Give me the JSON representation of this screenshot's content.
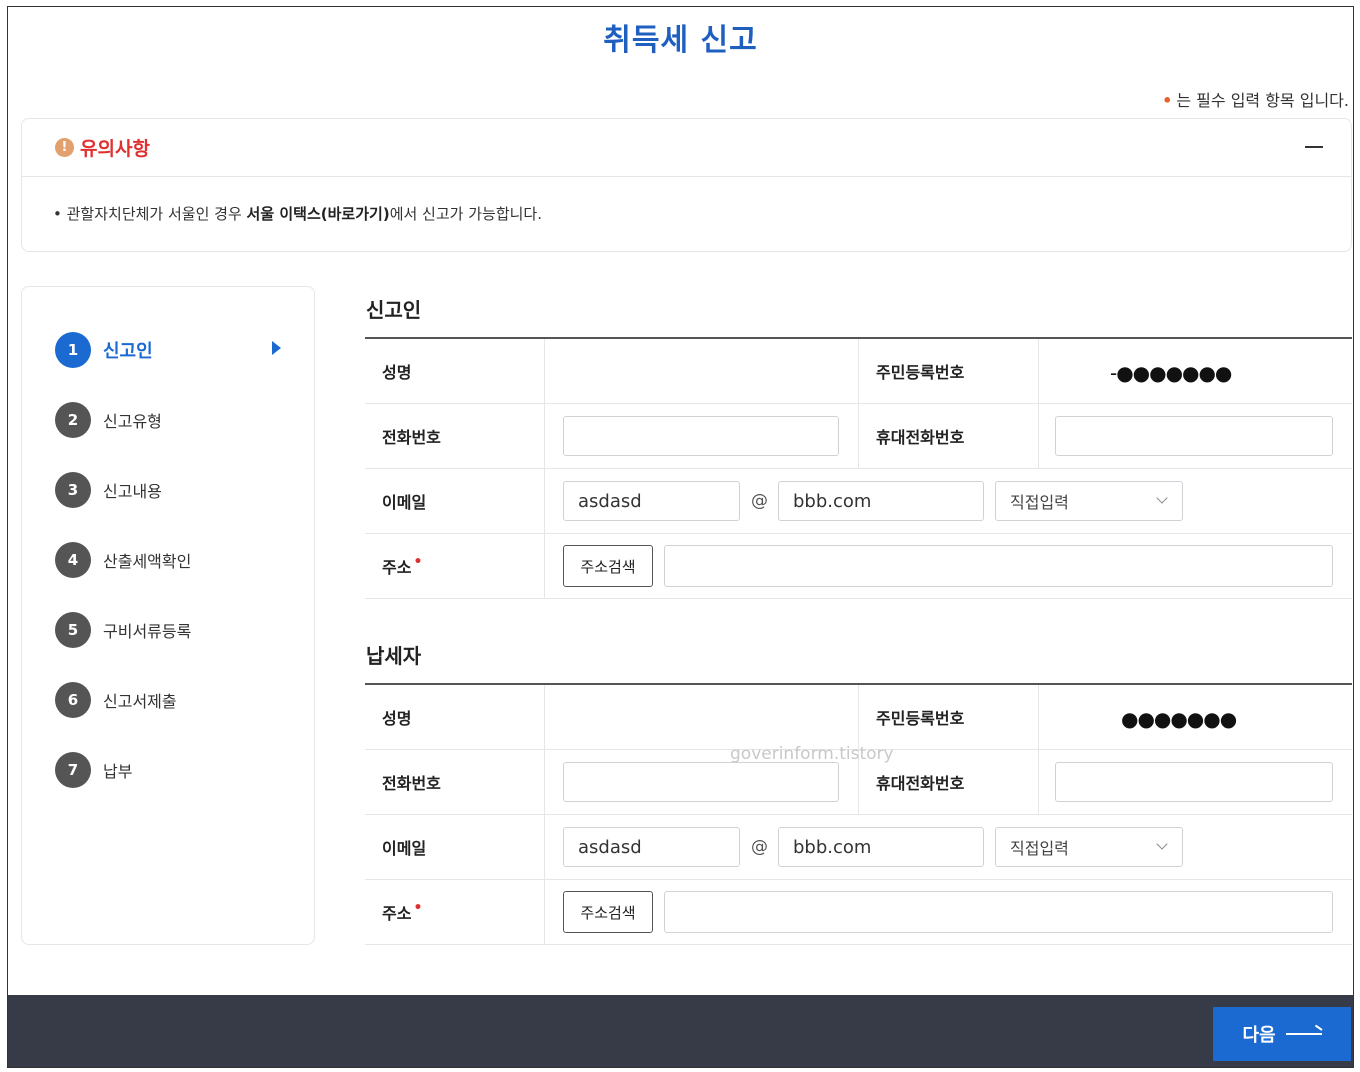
{
  "page": {
    "title": "취득세 신고",
    "required_note": "는 필수 입력 항목 입니다.",
    "required_dot": "•"
  },
  "notice": {
    "icon": "warning-icon",
    "icon_glyph": "!",
    "title": "유의사항",
    "bullet": "•",
    "text_before": " 관할자치단체가 서울인 경우 ",
    "text_bold": "서울 이택스(바로가기)",
    "text_after": "에서 신고가 가능합니다."
  },
  "steps": [
    {
      "num": "1",
      "label": "신고인",
      "active": true
    },
    {
      "num": "2",
      "label": "신고유형"
    },
    {
      "num": "3",
      "label": "신고내용"
    },
    {
      "num": "4",
      "label": "산출세액확인"
    },
    {
      "num": "5",
      "label": "구비서류등록"
    },
    {
      "num": "6",
      "label": "신고서제출"
    },
    {
      "num": "7",
      "label": "납부"
    }
  ],
  "reporter": {
    "section_title": "신고인",
    "name_label": "성명",
    "rrn_label": "주민등록번호",
    "rrn_value": "-●●●●●●●",
    "phone_label": "전화번호",
    "mobile_label": "휴대전화번호",
    "email_label": "이메일",
    "email_id": "asdasd",
    "at": "@",
    "email_domain": "bbb.com",
    "email_select": "직접입력",
    "address_label": "주소",
    "address_button": "주소검색"
  },
  "taxpayer": {
    "section_title": "납세자",
    "name_label": "성명",
    "rrn_label": "주민등록번호",
    "rrn_value": "●●●●●●●",
    "phone_label": "전화번호",
    "mobile_label": "휴대전화번호",
    "email_label": "이메일",
    "email_id": "asdasd",
    "at": "@",
    "email_domain": "bbb.com",
    "email_select": "직접입력",
    "address_label": "주소",
    "address_button": "주소검색"
  },
  "watermark": "goverinform.tistory",
  "footer": {
    "next_label": "다음"
  }
}
